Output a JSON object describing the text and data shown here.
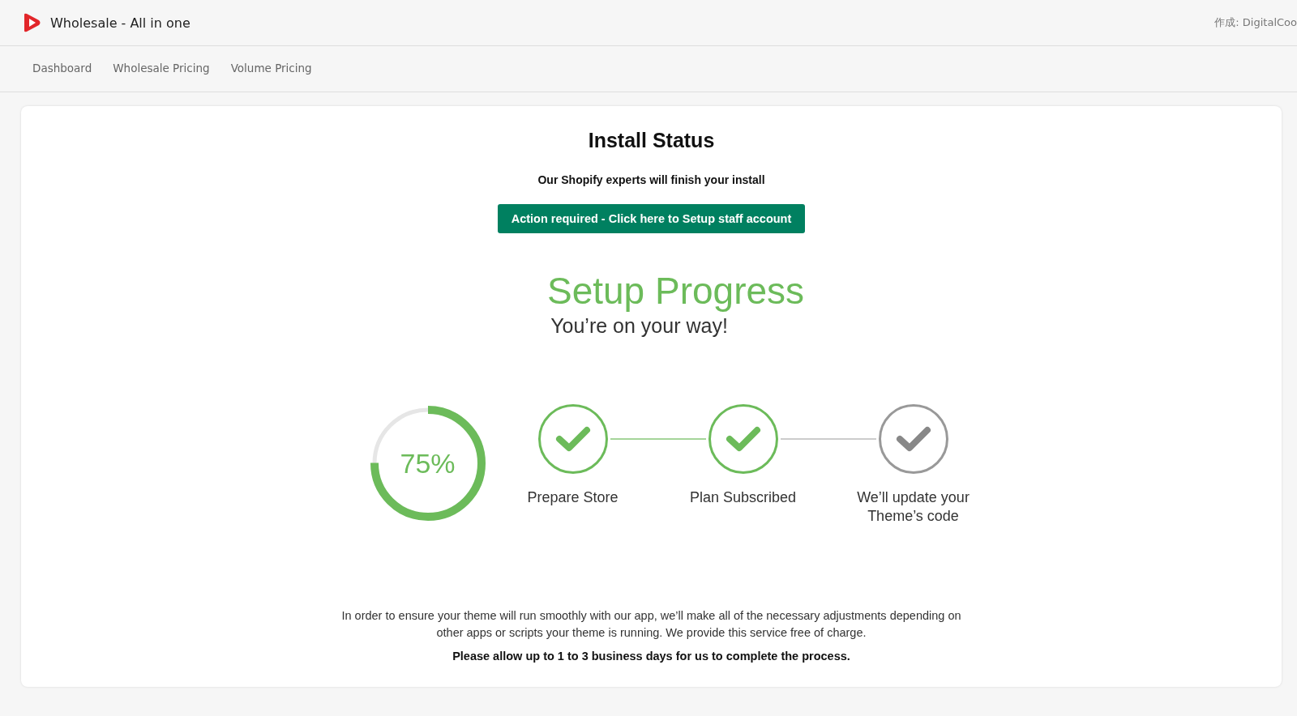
{
  "app_bar": {
    "title": "Wholesale - All in one",
    "author": "作成: DigitalCoo"
  },
  "tabs": [
    {
      "label": "Dashboard",
      "selected": false
    },
    {
      "label": "Wholesale Pricing",
      "selected": false
    },
    {
      "label": "Volume Pricing",
      "selected": false
    }
  ],
  "card": {
    "title": "Install Status",
    "subtitle": "Our Shopify experts will finish your install",
    "action_button": "Action required - Click here to Setup staff account",
    "progress": {
      "heading": "Setup Progress",
      "tagline": "You’re on your way!",
      "level": 0.75,
      "reading": "75%",
      "steps": [
        {
          "label": "Prepare Store",
          "completed": true
        },
        {
          "label": "Plan Subscribed",
          "completed": true
        },
        {
          "label": "We’ll update your Theme’s code",
          "completed": false
        }
      ]
    },
    "description": "In order to ensure your theme will run smoothly with our app, we’ll make all of the necessary adjustments depending on other apps or scripts your theme is running. We provide this service free of charge.",
    "note": "Please allow up to 1 to 3 business days for us to complete the process."
  }
}
